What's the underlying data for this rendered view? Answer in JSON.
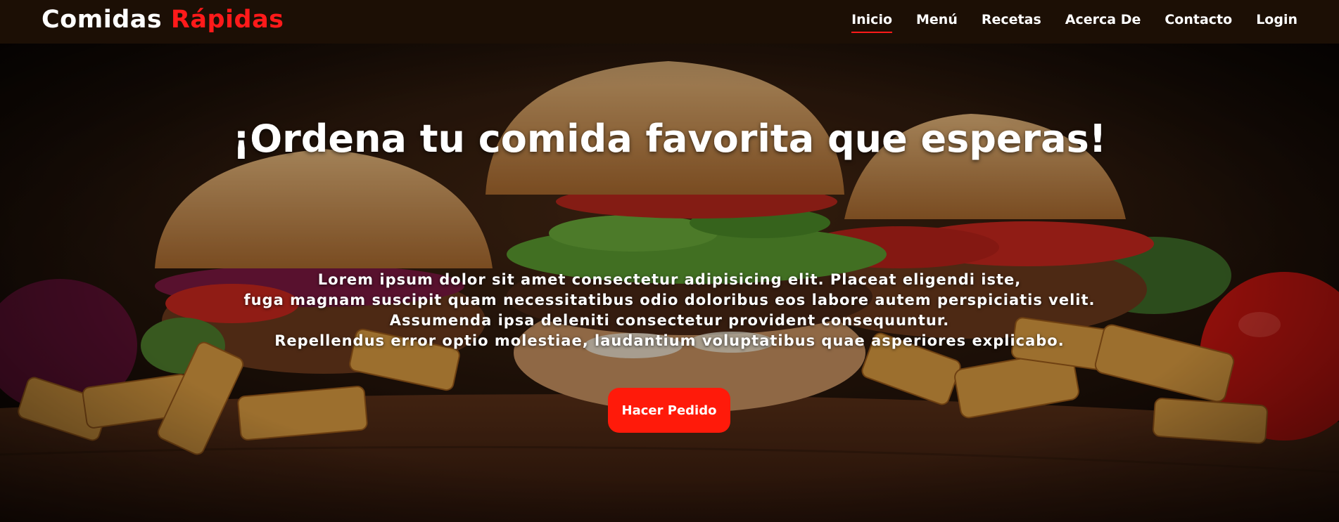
{
  "brand": {
    "name_white": "Comidas",
    "name_red": "Rápidas"
  },
  "nav": {
    "items": [
      {
        "label": "Inicio",
        "active": true
      },
      {
        "label": "Menú"
      },
      {
        "label": "Recetas"
      },
      {
        "label": "Acerca De"
      },
      {
        "label": "Contacto"
      },
      {
        "label": "Login"
      }
    ]
  },
  "hero": {
    "title": "¡Ordena tu comida favorita que esperas!",
    "lines": [
      "Lorem ipsum dolor sit amet consectetur adipisicing elit. Placeat eligendi iste,",
      "fuga magnam suscipit quam necessitatibus odio doloribus eos labore autem perspiciatis velit.",
      "Assumenda ipsa deleniti consectetur provident consequuntur.",
      "Repellendus error optio molestiae, laudantium voluptatibus quae asperiores explicabo."
    ],
    "button_label": "Hacer Pedido"
  },
  "colors": {
    "accent": "#ff1a1a",
    "navbar": "#1c0f05",
    "button": "#ff1a0a"
  }
}
